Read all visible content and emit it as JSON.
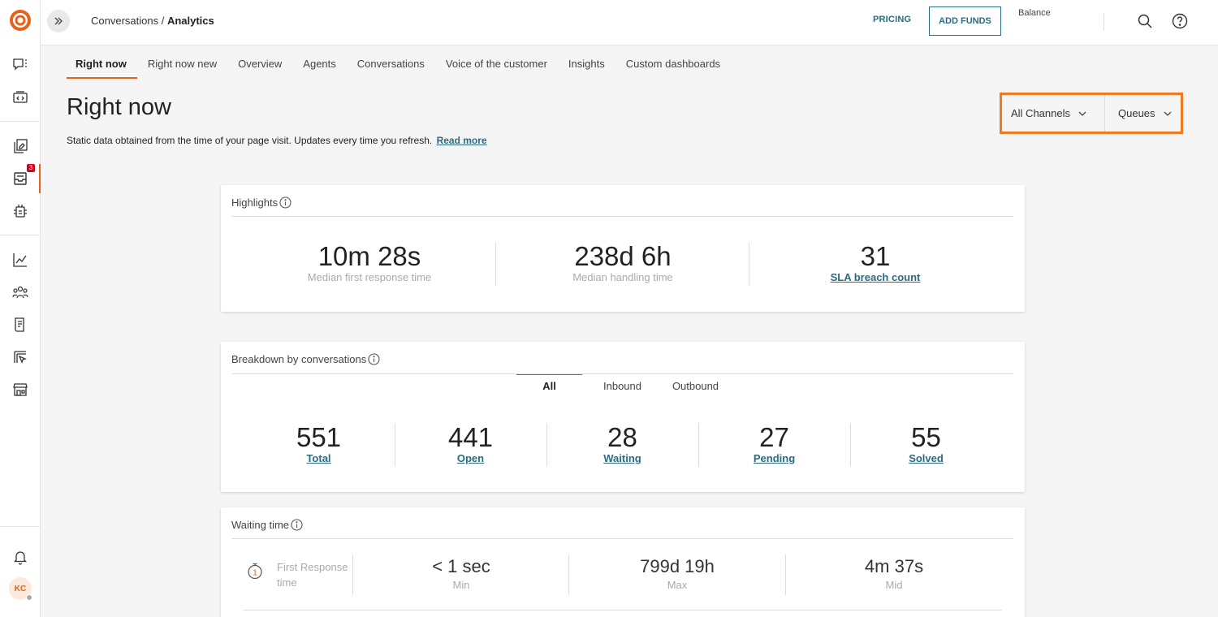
{
  "app": {
    "brand_color": "#e8611a",
    "link_color": "#2b6c80"
  },
  "sidebar": {
    "items": [
      {
        "icon": "chat-list-icon"
      },
      {
        "icon": "code-window-icon"
      },
      {
        "icon": "copy-edit-icon"
      },
      {
        "icon": "inbox-icon",
        "badge": "3"
      },
      {
        "icon": "bot-icon"
      },
      {
        "icon": "line-chart-icon"
      },
      {
        "icon": "people-icon"
      },
      {
        "icon": "document-icon"
      },
      {
        "icon": "cursor-box-icon"
      },
      {
        "icon": "store-icon"
      },
      {
        "icon": "bell-icon"
      }
    ],
    "avatar_initials": "KC"
  },
  "header": {
    "breadcrumb_parent": "Conversations",
    "breadcrumb_sep": " / ",
    "breadcrumb_current": "Analytics",
    "pricing_label": "PRICING",
    "add_funds_label": "ADD FUNDS",
    "balance_label": "Balance"
  },
  "tabs": [
    {
      "label": "Right now"
    },
    {
      "label": "Right now new"
    },
    {
      "label": "Overview"
    },
    {
      "label": "Agents"
    },
    {
      "label": "Conversations"
    },
    {
      "label": "Voice of the customer"
    },
    {
      "label": "Insights"
    },
    {
      "label": "Custom dashboards"
    }
  ],
  "page": {
    "title": "Right now",
    "subtitle": "Static data obtained from the time of your page visit. Updates every time you refresh.",
    "read_more": "Read more"
  },
  "filters": {
    "channels": "All Channels",
    "queues": "Queues"
  },
  "highlights": {
    "title": "Highlights",
    "metrics": [
      {
        "value": "10m 28s",
        "label": "Median first response time"
      },
      {
        "value": "238d 6h",
        "label": "Median handling time"
      },
      {
        "value": "31",
        "label": "SLA breach count"
      }
    ]
  },
  "breakdown": {
    "title": "Breakdown by conversations",
    "tabs": [
      "All",
      "Inbound",
      "Outbound"
    ],
    "metrics": [
      {
        "value": "551",
        "label": "Total"
      },
      {
        "value": "441",
        "label": "Open"
      },
      {
        "value": "28",
        "label": "Waiting"
      },
      {
        "value": "27",
        "label": "Pending"
      },
      {
        "value": "55",
        "label": "Solved"
      }
    ]
  },
  "waiting": {
    "title": "Waiting time",
    "row_label": "First Response time",
    "metrics": [
      {
        "value": "< 1 sec",
        "label": "Min"
      },
      {
        "value": "799d 19h",
        "label": "Max"
      },
      {
        "value": "4m 37s",
        "label": "Mid"
      }
    ]
  }
}
